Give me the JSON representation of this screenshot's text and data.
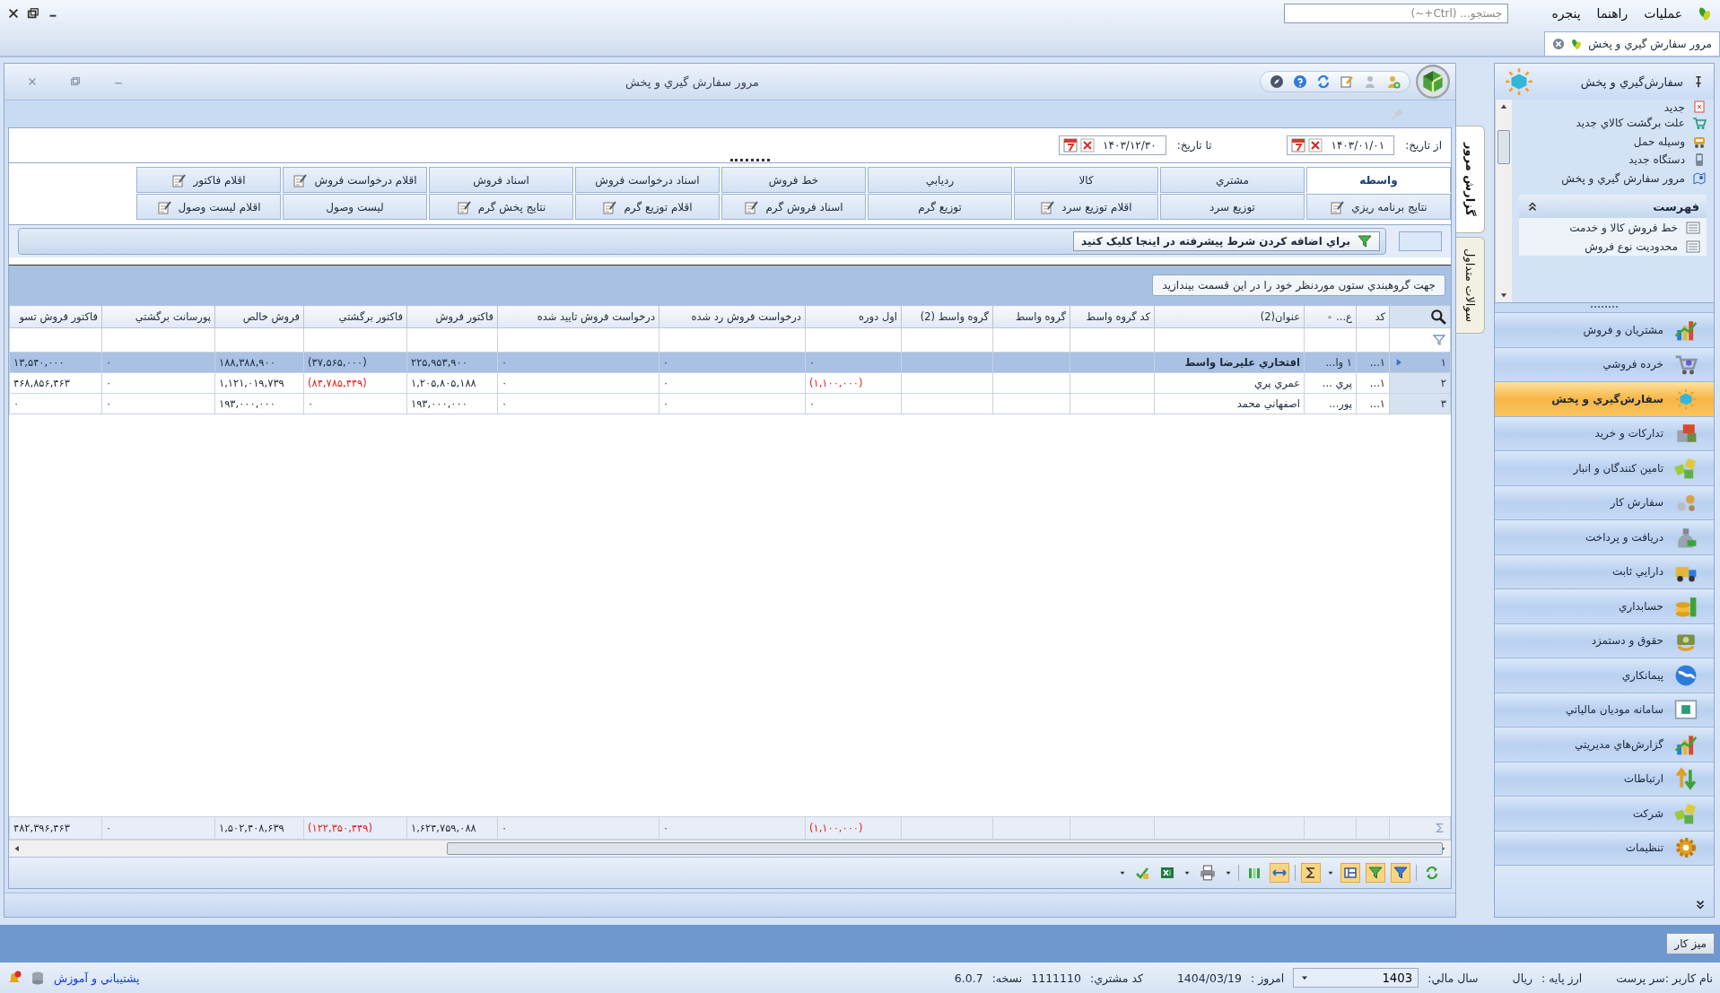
{
  "menu_bar": {
    "menus": [
      "عمليات",
      "راهنما",
      "پنجره"
    ],
    "search": {
      "placeholder": "جستجو... (Ctrl+~)"
    }
  },
  "document_tabs": [
    {
      "label": "مرور سفارش گيري و پخش",
      "selected": true
    }
  ],
  "window": {
    "title": "مرور سفارش گيري و پخش"
  },
  "date_range": {
    "from_label": "از تاريخ:",
    "from": "۱۴۰۳/۰۱/۰۱",
    "to_label": "تا تاريخ:",
    "to": "۱۴۰۳/۱۲/۳۰"
  },
  "tab_rows": [
    [
      {
        "label": "واسطه",
        "selected": true,
        "icon": false
      },
      {
        "label": "مشتري",
        "selected": false,
        "icon": false
      },
      {
        "label": "کالا",
        "selected": false,
        "icon": false
      },
      {
        "label": "رديابي",
        "selected": false,
        "icon": false
      },
      {
        "label": "خط فروش",
        "selected": false,
        "icon": false
      },
      {
        "label": "اسناد درخواست فروش",
        "selected": false,
        "icon": false
      },
      {
        "label": "اسناد فروش",
        "selected": false,
        "icon": false
      },
      {
        "label": "اقلام درخواست فروش",
        "selected": false,
        "icon": true
      },
      {
        "label": "اقلام فاکتور",
        "selected": false,
        "icon": true
      }
    ],
    [
      {
        "label": "نتايج برنامه ريزي",
        "selected": false,
        "icon": true
      },
      {
        "label": "توزيع سرد",
        "selected": false,
        "icon": false
      },
      {
        "label": "اقلام توزيع سرد",
        "selected": false,
        "icon": true
      },
      {
        "label": "توزيع گرم",
        "selected": false,
        "icon": false
      },
      {
        "label": "اسناد فروش گرم",
        "selected": false,
        "icon": true
      },
      {
        "label": "اقلام توزيع گرم",
        "selected": false,
        "icon": true
      },
      {
        "label": "نتايج پخش گرم",
        "selected": false,
        "icon": true
      },
      {
        "label": "ليست وصول",
        "selected": false,
        "icon": false
      },
      {
        "label": "اقلام ليست وصول",
        "selected": false,
        "icon": true
      }
    ]
  ],
  "filter_bar": {
    "text": "براي اضافه کردن شرط پيشرفته در اينجا کليک کنيد"
  },
  "grid": {
    "group_hint": "جهت گروهبندي ستون موردنظر خود را در اين قسمت بيندازيد",
    "columns": [
      {
        "label": "کد",
        "sorted": false
      },
      {
        "label": "ع...",
        "sorted": true
      },
      {
        "label": "عنوان(2)",
        "sorted": false
      },
      {
        "label": "کد گروه واسط",
        "sorted": false
      },
      {
        "label": "گروه واسط",
        "sorted": false
      },
      {
        "label": "گروه واسط (2)",
        "sorted": false
      },
      {
        "label": "اول دوره",
        "sorted": false
      },
      {
        "label": "درخواست فروش رد شده",
        "sorted": false
      },
      {
        "label": "درخواست فروش تاييد شده",
        "sorted": false
      },
      {
        "label": "فاکتور فروش",
        "sorted": false
      },
      {
        "label": "فاکتور برگشتي",
        "sorted": false
      },
      {
        "label": "فروش خالص",
        "sorted": false
      },
      {
        "label": "پورسانت برگشتي",
        "sorted": false
      },
      {
        "label": "فاکتور فروش تسو",
        "sorted": false
      }
    ],
    "rows": [
      {
        "number": "۱",
        "selected": true,
        "cells": [
          "۱...",
          "۱ وا...",
          "افتخاري عليرضا واسط",
          null,
          null,
          null,
          "۰",
          "۰",
          "۰",
          "۲۲۵,۹۵۳,۹۰۰",
          {
            "text": "(۳۷,۵۶۵,۰۰۰)",
            "kind": "plain"
          },
          "۱۸۸,۳۸۸,۹۰۰",
          "۰",
          "۱۳,۵۴۰,۰۰۰"
        ]
      },
      {
        "number": "۲",
        "selected": false,
        "cells": [
          "۱...",
          "پري ...",
          "عمري پري",
          null,
          null,
          null,
          {
            "text": "(۱,۱۰۰,۰۰۰)",
            "kind": "negative"
          },
          "۰",
          "۰",
          "۱,۲۰۵,۸۰۵,۱۸۸",
          {
            "text": "(۸۴,۷۸۵,۴۴۹)",
            "kind": "negative"
          },
          "۱,۱۲۱,۰۱۹,۷۳۹",
          "۰",
          "۴۶۸,۸۵۶,۴۶۳"
        ]
      },
      {
        "number": "۳",
        "selected": false,
        "cells": [
          "۱...",
          "پور...",
          "اصفهاني محمد",
          null,
          null,
          null,
          "۰",
          "۰",
          "۰",
          "۱۹۳,۰۰۰,۰۰۰",
          "۰",
          "۱۹۳,۰۰۰,۰۰۰",
          "۰",
          "۰"
        ]
      }
    ],
    "totals": [
      {
        "text": "(۱,۱۰۰,۰۰۰)",
        "kind": "negative"
      },
      "۰",
      "۰",
      "۱,۶۲۴,۷۵۹,۰۸۸",
      {
        "text": "(۱۲۲,۳۵۰,۴۴۹)",
        "kind": "negative"
      },
      "۱,۵۰۲,۴۰۸,۶۳۹",
      "۰",
      "۴۸۲,۳۹۶,۴۶۳"
    ]
  },
  "vertical_tabs": [
    {
      "label": "گزارش مرور",
      "selected": true
    },
    {
      "label": "سوالات متداول",
      "selected": false
    }
  ],
  "sidebar": {
    "title": "سفارش‌گيري و پخش",
    "shortcuts": [
      "جديد",
      "علت برگشت کالاي جديد",
      "وسيله حمل",
      "دستگاه جديد",
      "مرور سفارش گيري و پخش"
    ],
    "list_group": {
      "title": "فهرست",
      "items": [
        "خط فروش کالا و خدمت",
        "محدوديت نوع فروش"
      ]
    },
    "modules": [
      {
        "label": "مشتريان و فروش",
        "selected": false
      },
      {
        "label": "خرده فروشي",
        "selected": false
      },
      {
        "label": "سفارش‌گيري و پخش",
        "selected": true
      },
      {
        "label": "تدارکات و خريد",
        "selected": false
      },
      {
        "label": "تامين کنندگان و انبار",
        "selected": false
      },
      {
        "label": "سفارش کار",
        "selected": false
      },
      {
        "label": "دريافت و پرداخت",
        "selected": false
      },
      {
        "label": "دارايي ثابت",
        "selected": false
      },
      {
        "label": "حسابداري",
        "selected": false
      },
      {
        "label": "حقوق و دستمزد",
        "selected": false
      },
      {
        "label": "پيمانکاري",
        "selected": false
      },
      {
        "label": "سامانه موديان مالياتي",
        "selected": false
      },
      {
        "label": "گزارش‌هاي مديريتي",
        "selected": false
      },
      {
        "label": "ارتباطات",
        "selected": false
      },
      {
        "label": "شرکت",
        "selected": false
      },
      {
        "label": "تنظيمات",
        "selected": false
      }
    ]
  },
  "taskbar": {
    "buttons": [
      "ميز کار"
    ]
  },
  "status_bar": {
    "user_label": "نام کاربر :سر پرست",
    "currency_label": "ارز پايه :",
    "currency": "ريال",
    "fiscal_year_label": "سال مالي:",
    "fiscal_year": "1403",
    "today_label": "امروز :",
    "today": "1404/03/19",
    "customer_code_label": "کد مشتري:",
    "customer_code": "1111110",
    "version_label": "نسخه:",
    "version": "6.0.7",
    "support_link": "پشتيباني و آموزش"
  }
}
